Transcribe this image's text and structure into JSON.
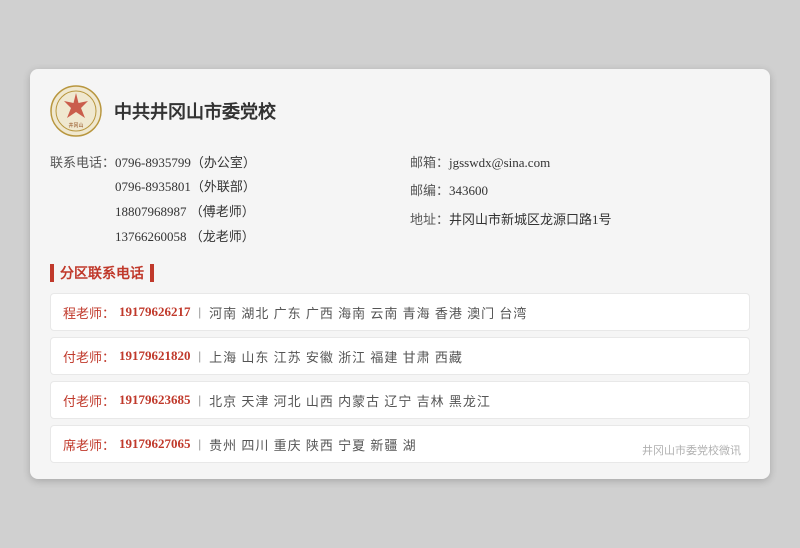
{
  "org": {
    "name": "中共井冈山市委党校",
    "logo_alt": "党校徽章"
  },
  "contact": {
    "phone_label": "联系电话：",
    "phones": [
      {
        "number": "0796-8935799",
        "note": "（办公室）"
      },
      {
        "number": "0796-8935801",
        "note": "（外联部）"
      },
      {
        "number": "18807968987",
        "note": "  （傅老师）"
      },
      {
        "number": "13766260058",
        "note": "  （龙老师）"
      }
    ],
    "email_label": "邮箱：",
    "email": "jgsswdx@sina.com",
    "postal_label": "邮编：",
    "postal": "343600",
    "address_label": "地址：",
    "address": "井冈山市新城区龙源口路1号"
  },
  "section_title": "分区联系电话",
  "regions": [
    {
      "teacher": "程老师：",
      "phone": "19179626217",
      "areas": "河南  湖北  广东  广西  海南  云南  青海  香港  澳门  台湾"
    },
    {
      "teacher": "付老师：",
      "phone": "19179621820",
      "areas": "上海  山东  江苏  安徽  浙江  福建  甘肃  西藏"
    },
    {
      "teacher": "付老师：",
      "phone": "19179623685",
      "areas": "北京  天津  河北  山西  内蒙古  辽宁  吉林  黑龙江"
    },
    {
      "teacher": "席老师：",
      "phone": "19179627065",
      "areas": "贵州  四川  重庆  陕西  宁夏  新疆  湖..."
    }
  ],
  "watermark": "井冈山市委党校微讯"
}
